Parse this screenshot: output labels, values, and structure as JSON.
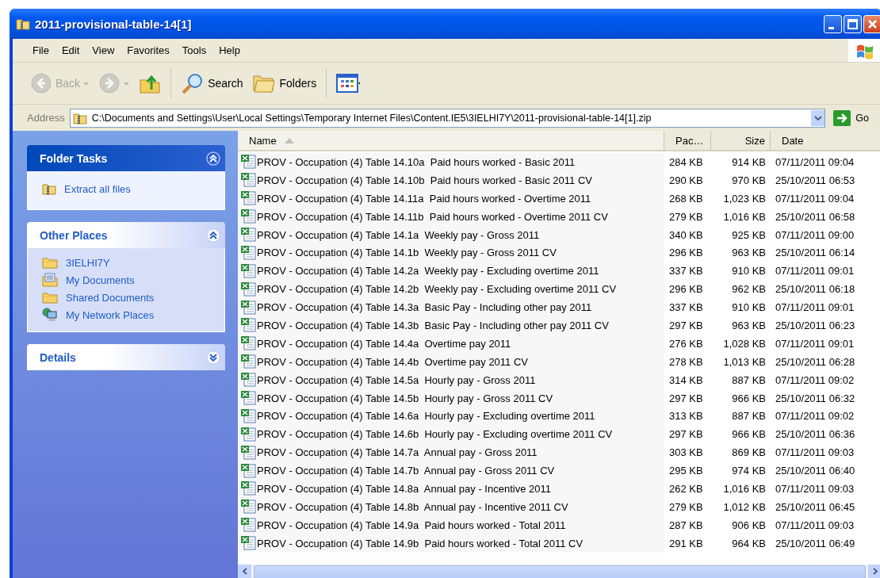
{
  "window": {
    "title": "2011-provisional-table-14[1]"
  },
  "menu": [
    "File",
    "Edit",
    "View",
    "Favorites",
    "Tools",
    "Help"
  ],
  "toolbar": [
    {
      "kind": "back",
      "label": "Back",
      "disabled": true
    },
    {
      "kind": "forward",
      "disabled": true
    },
    {
      "kind": "up",
      "disabled": false
    },
    {
      "kind": "search",
      "label": "Search",
      "disabled": false
    },
    {
      "kind": "folders",
      "label": "Folders",
      "disabled": false
    },
    {
      "kind": "views",
      "disabled": false
    }
  ],
  "address": {
    "label": "Address",
    "value": "C:\\Documents and Settings\\User\\Local Settings\\Temporary Internet Files\\Content.IE5\\3IELHI7Y\\2011-provisional-table-14[1].zip",
    "go": "Go"
  },
  "sidebar": {
    "panels": [
      {
        "title": "Folder Tasks",
        "kind": "special",
        "expanded": true,
        "items": [
          {
            "label": "Extract all files",
            "kind": "zip"
          }
        ]
      },
      {
        "title": "Other Places",
        "kind": "normal",
        "expanded": true,
        "items": [
          {
            "label": "3IELHI7Y",
            "kind": "folder"
          },
          {
            "label": "My Documents",
            "kind": "documents"
          },
          {
            "label": "Shared Documents",
            "kind": "folder"
          },
          {
            "label": "My Network Places",
            "kind": "network"
          }
        ]
      },
      {
        "title": "Details",
        "kind": "normal",
        "expanded": false
      }
    ]
  },
  "table": {
    "columns": [
      {
        "label": "Name",
        "sorted": true
      },
      {
        "label": "Pac…",
        "sorted": false
      },
      {
        "label": "Size",
        "sorted": false
      },
      {
        "label": "Date",
        "sorted": false
      }
    ],
    "rows": [
      [
        "PROV - Occupation (4) Table 14.10a  Paid hours worked - Basic 2011",
        "284 KB",
        "914 KB",
        "07/11/2011 09:04"
      ],
      [
        "PROV - Occupation (4) Table 14.10b  Paid hours worked - Basic 2011 CV",
        "290 KB",
        "970 KB",
        "25/10/2011 06:53"
      ],
      [
        "PROV - Occupation (4) Table 14.11a  Paid hours worked - Overtime 2011",
        "268 KB",
        "1,023 KB",
        "07/11/2011 09:04"
      ],
      [
        "PROV - Occupation (4) Table 14.11b  Paid hours worked - Overtime 2011 CV",
        "279 KB",
        "1,016 KB",
        "25/10/2011 06:58"
      ],
      [
        "PROV - Occupation (4) Table 14.1a  Weekly pay - Gross 2011",
        "340 KB",
        "925 KB",
        "07/11/2011 09:00"
      ],
      [
        "PROV - Occupation (4) Table 14.1b  Weekly pay - Gross 2011 CV",
        "296 KB",
        "963 KB",
        "25/10/2011 06:14"
      ],
      [
        "PROV - Occupation (4) Table 14.2a  Weekly pay - Excluding overtime 2011",
        "337 KB",
        "910 KB",
        "07/11/2011 09:01"
      ],
      [
        "PROV - Occupation (4) Table 14.2b  Weekly pay - Excluding overtime 2011 CV",
        "296 KB",
        "962 KB",
        "25/10/2011 06:18"
      ],
      [
        "PROV - Occupation (4) Table 14.3a  Basic Pay - Including other pay 2011",
        "337 KB",
        "910 KB",
        "07/11/2011 09:01"
      ],
      [
        "PROV - Occupation (4) Table 14.3b  Basic Pay - Including other pay 2011 CV",
        "297 KB",
        "963 KB",
        "25/10/2011 06:23"
      ],
      [
        "PROV - Occupation (4) Table 14.4a  Overtime pay 2011",
        "276 KB",
        "1,028 KB",
        "07/11/2011 09:01"
      ],
      [
        "PROV - Occupation (4) Table 14.4b  Overtime pay 2011 CV",
        "278 KB",
        "1,013 KB",
        "25/10/2011 06:28"
      ],
      [
        "PROV - Occupation (4) Table 14.5a  Hourly pay - Gross 2011",
        "314 KB",
        "887 KB",
        "07/11/2011 09:02"
      ],
      [
        "PROV - Occupation (4) Table 14.5b  Hourly pay - Gross 2011 CV",
        "297 KB",
        "966 KB",
        "25/10/2011 06:32"
      ],
      [
        "PROV - Occupation (4) Table 14.6a  Hourly pay - Excluding overtime 2011",
        "313 KB",
        "887 KB",
        "07/11/2011 09:02"
      ],
      [
        "PROV - Occupation (4) Table 14.6b  Hourly pay - Excluding overtime 2011 CV",
        "297 KB",
        "966 KB",
        "25/10/2011 06:36"
      ],
      [
        "PROV - Occupation (4) Table 14.7a  Annual pay - Gross 2011",
        "303 KB",
        "869 KB",
        "07/11/2011 09:03"
      ],
      [
        "PROV - Occupation (4) Table 14.7b  Annual pay - Gross 2011 CV",
        "295 KB",
        "974 KB",
        "25/10/2011 06:40"
      ],
      [
        "PROV - Occupation (4) Table 14.8a  Annual pay - Incentive 2011",
        "262 KB",
        "1,016 KB",
        "07/11/2011 09:03"
      ],
      [
        "PROV - Occupation (4) Table 14.8b  Annual pay - Incentive 2011 CV",
        "279 KB",
        "1,012 KB",
        "25/10/2011 06:45"
      ],
      [
        "PROV - Occupation (4) Table 14.9a  Paid hours worked - Total 2011",
        "287 KB",
        "906 KB",
        "07/11/2011 09:03"
      ],
      [
        "PROV - Occupation (4) Table 14.9b  Paid hours worked - Total 2011 CV",
        "291 KB",
        "964 KB",
        "25/10/2011 06:49"
      ]
    ]
  }
}
